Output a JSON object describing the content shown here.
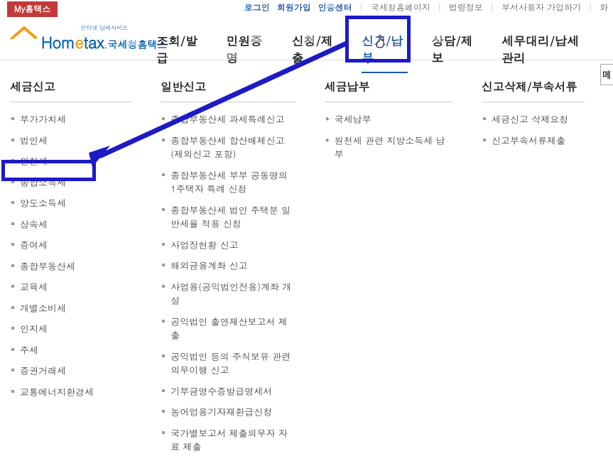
{
  "top_button": "My홈택스",
  "top_links": {
    "login": "로그인",
    "signup": "회원가입",
    "cert": "인증센터",
    "home": "국세청홈페이지",
    "law": "법령정보",
    "dept_signup": "부서사용자 가입하기",
    "screen": "화"
  },
  "logo": {
    "small": "인터넷 납세서비스",
    "home": "Hom",
    "e": "e",
    "tax": "tax",
    "sub": "국세청홈택스"
  },
  "nav": {
    "item1": "조회/발급",
    "item2": "민원증명",
    "item3": "신청/제출",
    "item4": "신고/납부",
    "item5": "상담/제보",
    "item6": "세무대리/납세관리"
  },
  "side_btn": "메",
  "columns": {
    "col1": {
      "title": "세금신고",
      "items": [
        "부가가치세",
        "법인세",
        "원천세",
        "종합소득세",
        "양도소득세",
        "상속세",
        "증여세",
        "종합부동산세",
        "교육세",
        "개별소비세",
        "인지세",
        "주세",
        "증권거래세",
        "교통에너지환경세"
      ]
    },
    "col2": {
      "title": "일반신고",
      "items": [
        "종합부동산세 과세특례신고",
        "종합부동산세 합산배제신고(제외신고 포함)",
        "종합부동산세 부부 공동명의 1주택자 특례 신청",
        "종합부동산세 법인 주택분 일반세율 적용 신청",
        "사업장현황 신고",
        "해외금융계좌 신고",
        "사업용(공익법인전용)계좌 개설",
        "공익법인 출연재산보고서 제출",
        "공익법인 등의 주식보유 관련 의무이행 신고",
        "기부금영수증발급명세서",
        "농어업용기자재환급신청",
        "국가별보고서 제출의무자 자료 제출"
      ]
    },
    "col3": {
      "title": "세금납부",
      "items": [
        "국세납부",
        "원천세 관련 지방소득세 납부"
      ]
    },
    "col4": {
      "title": "신고삭제/부속서류",
      "items": [
        "세금신고 삭제요청",
        "신고부속서류제출"
      ]
    }
  }
}
